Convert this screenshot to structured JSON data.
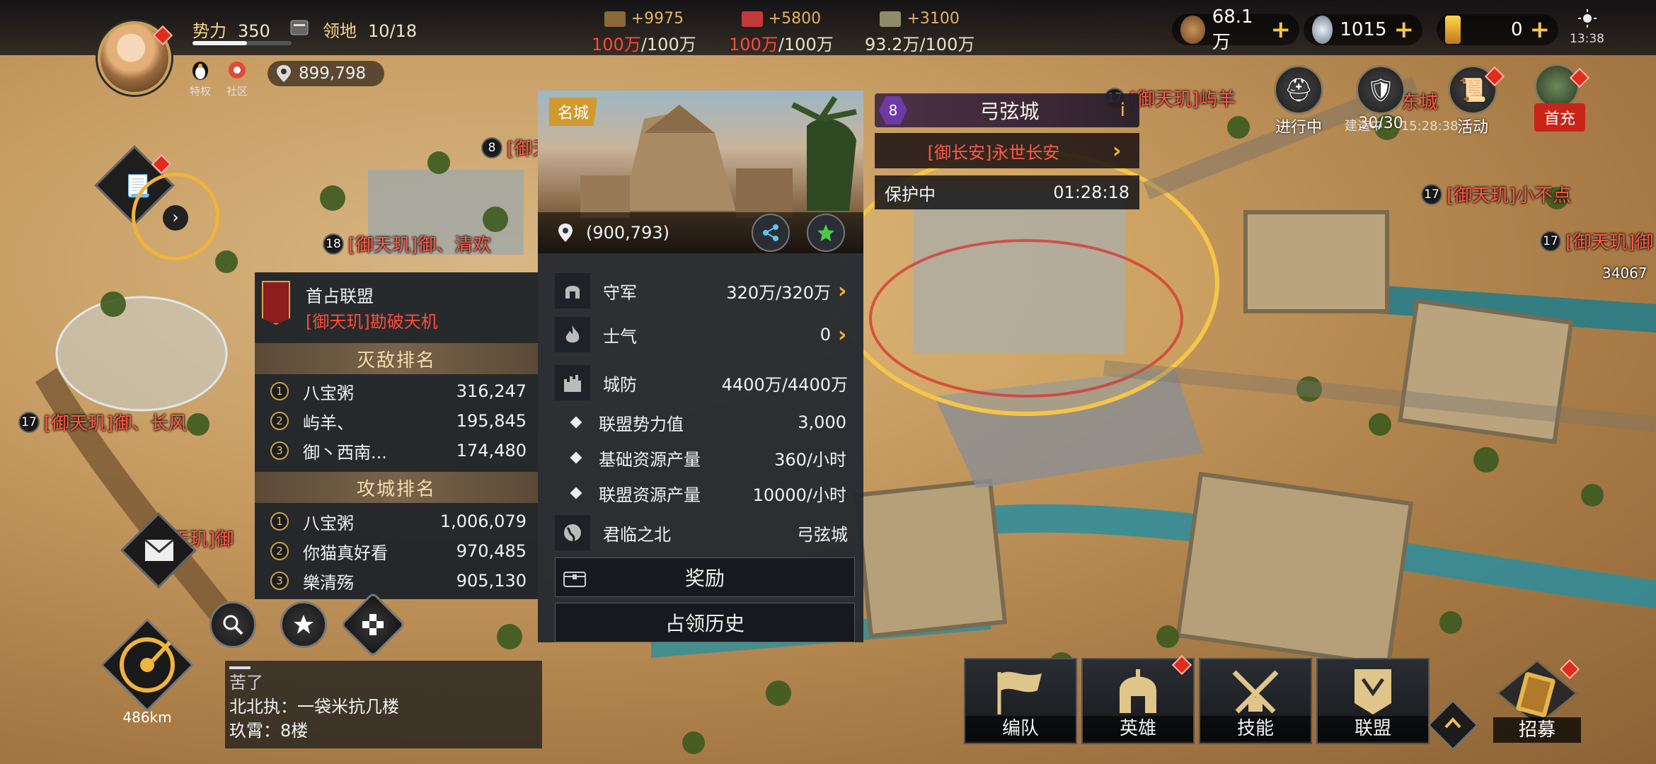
{
  "top": {
    "power_label": "势力",
    "power_value": "350",
    "territory_label": "领地",
    "territory_value": "10/18",
    "privilege_label": "特权",
    "community_label": "社区",
    "position": "899,798",
    "power_progress_fraction": 0.55
  },
  "resources": [
    {
      "name": "wood",
      "gain": "+9975",
      "cap_cur": "100万",
      "cap_max": "/100万",
      "full": true,
      "color": "#8a6a3a"
    },
    {
      "name": "iron",
      "gain": "+5800",
      "cap_cur": "100万",
      "cap_max": "/100万",
      "full": true,
      "color": "#c43a3a"
    },
    {
      "name": "grain",
      "gain": "+3100",
      "cap_cur": "93.2万",
      "cap_max": "/100万",
      "full": false,
      "color": "#8c8c6a"
    }
  ],
  "currencies": [
    {
      "name": "copper",
      "value": "68.1万",
      "icon": "copper-coin-icon"
    },
    {
      "name": "silver",
      "value": "1015",
      "icon": "silver-coin-icon"
    },
    {
      "name": "gold",
      "value": "0",
      "icon": "gold-bar-icon"
    }
  ],
  "clock": "13:38",
  "top_buttons": {
    "in_progress": "进行中",
    "queue": "30/30",
    "activity": "活动",
    "first_charge": "首充",
    "timer": "15:28:38",
    "build_label": "建造中"
  },
  "map_labels": [
    {
      "lv": "8",
      "text": "[御天玑]"
    },
    {
      "lv": "18",
      "text": "[御天玑]御、清欢"
    },
    {
      "lv": "17",
      "text": "[御天玑]御、长风"
    },
    {
      "lv": "",
      "text": "天玑]御"
    },
    {
      "lv": "17",
      "text": "[御天玑]屿羊"
    },
    {
      "lv": "",
      "text": "东城"
    },
    {
      "lv": "17",
      "text": "[御天玑]小不点"
    },
    {
      "lv": "17",
      "text": "[御天玑]御"
    },
    {
      "lv": "",
      "text": "34067"
    }
  ],
  "alliance_panel": {
    "title": "首占联盟",
    "name": "[御天玑]勘破天机",
    "kill_rank_title": "灭敌排名",
    "kill_rank": [
      {
        "n": "1",
        "name": "八宝粥",
        "score": "316,247"
      },
      {
        "n": "2",
        "name": "屿羊、",
        "score": "195,845"
      },
      {
        "n": "3",
        "name": "御丶西南...",
        "score": "174,480"
      }
    ],
    "siege_rank_title": "攻城排名",
    "siege_rank": [
      {
        "n": "1",
        "name": "八宝粥",
        "score": "1,006,079"
      },
      {
        "n": "2",
        "name": "你猫真好看",
        "score": "970,485"
      },
      {
        "n": "3",
        "name": "樂清殇",
        "score": "905,130"
      }
    ]
  },
  "city_card": {
    "tag": "名城",
    "coords": "(900,793)",
    "garrison_label": "守军",
    "garrison_value": "320万/320万",
    "morale_label": "士气",
    "morale_value": "0",
    "defense_label": "城防",
    "defense_value": "4400万/4400万",
    "alliance_power_label": "联盟势力值",
    "alliance_power_value": "3,000",
    "base_res_label": "基础资源产量",
    "base_res_value": "360/小时",
    "alliance_res_label": "联盟资源产量",
    "alliance_res_value": "10000/小时",
    "region_label": "君临之北",
    "region_value": "弓弦城",
    "reward_button": "奖励",
    "history_button": "占领历史"
  },
  "city_header": {
    "level": "8",
    "name": "弓弦城",
    "info": "i",
    "owner": "[御长安]永世长安",
    "status": "保护中",
    "timer": "01:28:18"
  },
  "compass": {
    "distance": "486km"
  },
  "chat": {
    "line1": "苦了",
    "line2": "北北执：一袋米抗几楼",
    "line3": "玖霄：8楼"
  },
  "actions": [
    {
      "label": "编队",
      "icon": "flag-icon"
    },
    {
      "label": "英雄",
      "icon": "helmet-icon"
    },
    {
      "label": "技能",
      "icon": "crossed-swords-icon"
    },
    {
      "label": "联盟",
      "icon": "banner-icon"
    }
  ],
  "recruit_label": "招募",
  "colors": {
    "accent_gold": "#f0b43c",
    "enemy_red": "#ff4a3a",
    "panel": "#24282e"
  }
}
